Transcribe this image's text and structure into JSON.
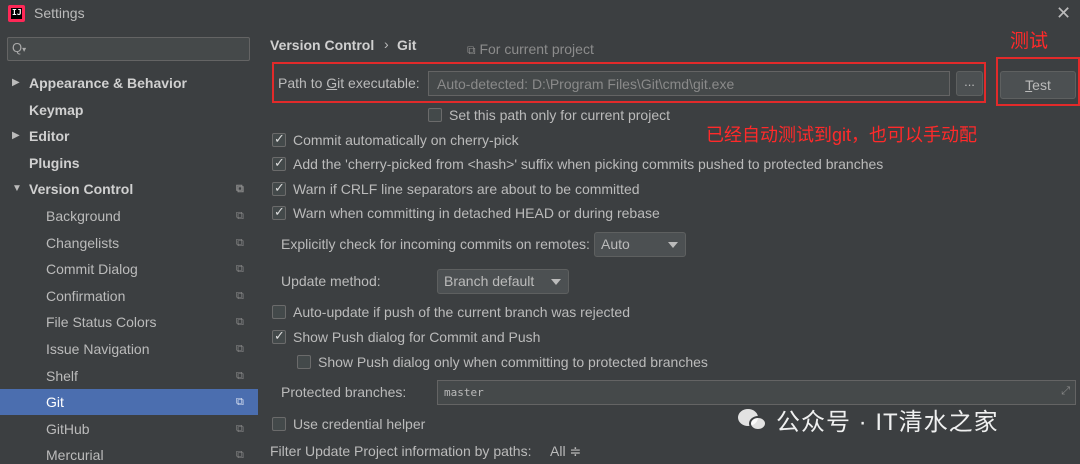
{
  "window": {
    "title": "Settings",
    "app_icon_text": "IJ",
    "close_glyph": "✕"
  },
  "sidebar": {
    "search_placeholder": "Q",
    "items": [
      {
        "label": "Appearance & Behavior",
        "bold": true,
        "expandable": true,
        "expanded": false
      },
      {
        "label": "Keymap",
        "bold": true
      },
      {
        "label": "Editor",
        "bold": true,
        "expandable": true,
        "expanded": false
      },
      {
        "label": "Plugins",
        "bold": true
      },
      {
        "label": "Version Control",
        "bold": true,
        "expandable": true,
        "expanded": true
      },
      {
        "label": "Background"
      },
      {
        "label": "Changelists"
      },
      {
        "label": "Commit Dialog"
      },
      {
        "label": "Confirmation"
      },
      {
        "label": "File Status Colors"
      },
      {
        "label": "Issue Navigation"
      },
      {
        "label": "Shelf"
      },
      {
        "label": "Git",
        "selected": true
      },
      {
        "label": "GitHub"
      },
      {
        "label": "Mercurial"
      }
    ],
    "selected_color": "#4b6eaf"
  },
  "breadcrumb": {
    "parent": "Version Control",
    "separator": "›",
    "current": "Git",
    "scope": "For current project"
  },
  "git_path": {
    "label": "Path to Git executable:",
    "value": "Auto-detected: D:\\Program Files\\Git\\cmd\\git.exe",
    "browse_label": "...",
    "test_label": "Test",
    "only_current_project": {
      "label": "Set this path only for current project",
      "checked": false
    }
  },
  "options": {
    "commit_cherry_pick": {
      "label": "Commit automatically on cherry-pick",
      "checked": true
    },
    "cherry_suffix": {
      "label": "Add the 'cherry-picked from <hash>' suffix when picking commits pushed to protected branches",
      "checked": true
    },
    "warn_crlf": {
      "label": "Warn if CRLF line separators are about to be committed",
      "checked": true
    },
    "warn_detached": {
      "label": "Warn when committing in detached HEAD or during rebase",
      "checked": true
    },
    "incoming_label": "Explicitly check for incoming commits on remotes:",
    "incoming_value": "Auto",
    "update_method_label": "Update method:",
    "update_method_value": "Branch default",
    "auto_update": {
      "label": "Auto-update if push of the current branch was rejected",
      "checked": false
    },
    "show_push": {
      "label": "Show Push dialog for Commit and Push",
      "checked": true
    },
    "show_push_protected": {
      "label": "Show Push dialog only when committing to protected branches",
      "checked": false
    },
    "protected_label": "Protected branches:",
    "protected_value": "master",
    "credential_helper": {
      "label": "Use credential helper",
      "checked": false
    },
    "filter_label": "Filter Update Project information by paths:",
    "filter_value": "All ≑"
  },
  "annotations": {
    "test_note": "测试",
    "main_note": "已经自动测试到git，也可以手动配",
    "color": "#ff2a2a"
  },
  "watermark": {
    "text": "公众号 · IT清水之家"
  }
}
